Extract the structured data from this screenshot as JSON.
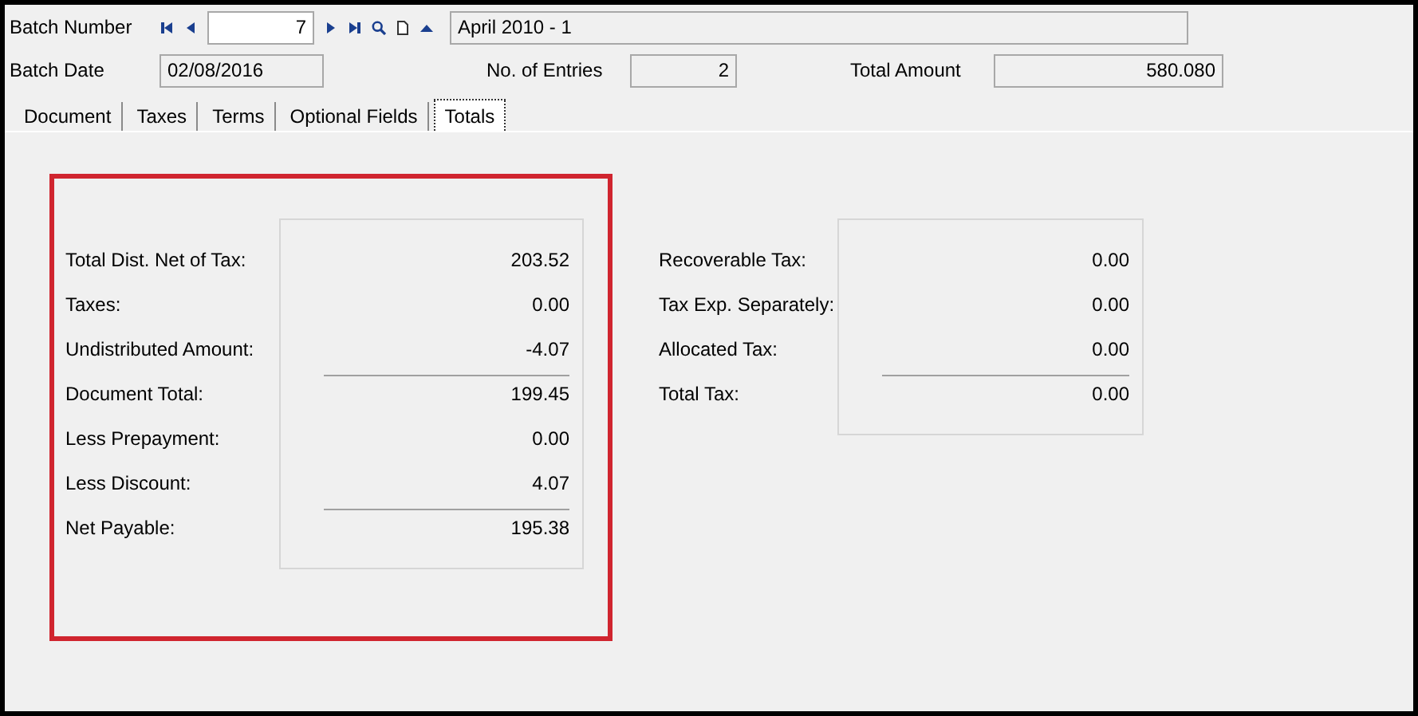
{
  "header": {
    "batch_number": {
      "label": "Batch Number",
      "value": "7",
      "description": "April 2010 - 1"
    },
    "batch_date": {
      "label": "Batch Date",
      "value": "02/08/2016"
    },
    "entries": {
      "label": "No. of Entries",
      "value": "2"
    },
    "total_amount": {
      "label": "Total Amount",
      "value": "580.080"
    }
  },
  "tabs": [
    {
      "label": "Document",
      "selected": false
    },
    {
      "label": "Taxes",
      "selected": false
    },
    {
      "label": "Terms",
      "selected": false
    },
    {
      "label": "Optional Fields",
      "selected": false
    },
    {
      "label": "Totals",
      "selected": true
    }
  ],
  "totals": [
    {
      "label": "Total Dist. Net of Tax:",
      "value": "203.52",
      "rule_above": false
    },
    {
      "label": "Taxes:",
      "value": "0.00",
      "rule_above": false
    },
    {
      "label": "Undistributed Amount:",
      "value": "-4.07",
      "rule_above": false
    },
    {
      "label": "Document Total:",
      "value": "199.45",
      "rule_above": true
    },
    {
      "label": "Less Prepayment:",
      "value": "0.00",
      "rule_above": false
    },
    {
      "label": "Less Discount:",
      "value": "4.07",
      "rule_above": false
    },
    {
      "label": "Net Payable:",
      "value": "195.38",
      "rule_above": true
    }
  ],
  "taxes": [
    {
      "label": "Recoverable Tax:",
      "value": "0.00",
      "rule_above": false
    },
    {
      "label": "Tax Exp. Separately:",
      "value": "0.00",
      "rule_above": false
    },
    {
      "label": "Allocated Tax:",
      "value": "0.00",
      "rule_above": false
    },
    {
      "label": "Total Tax:",
      "value": "0.00",
      "rule_above": true
    }
  ]
}
